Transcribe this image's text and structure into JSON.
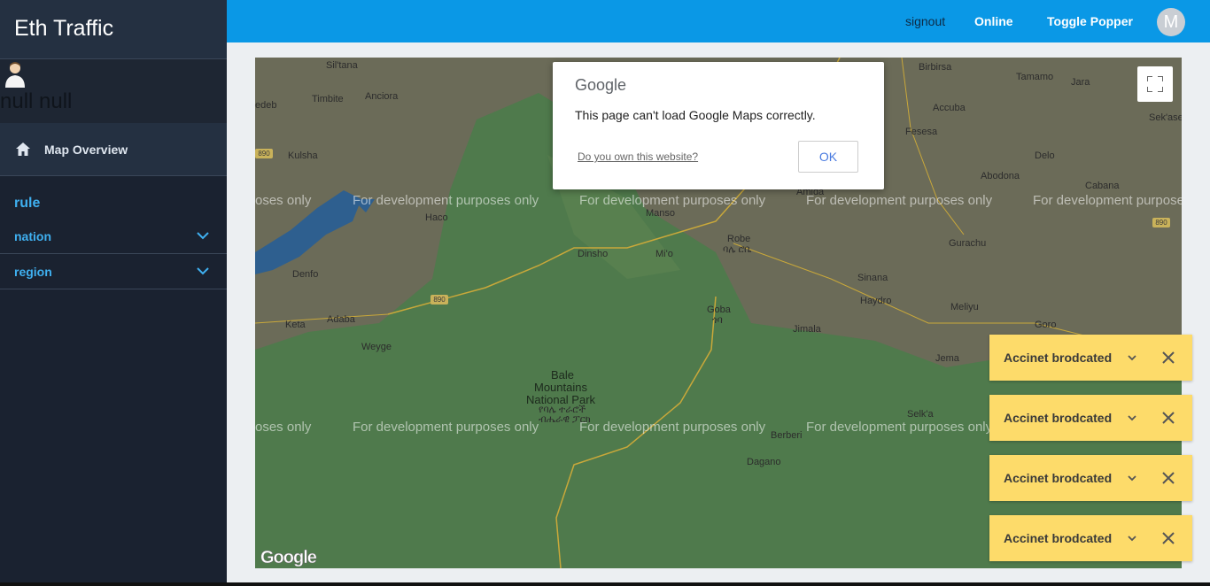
{
  "app": {
    "brand": "Eth Traffic"
  },
  "user": {
    "name": "null null"
  },
  "sidebar": {
    "overview_label": "Map Overview",
    "rule_label": "rule",
    "menus": [
      {
        "label": "nation"
      },
      {
        "label": "region"
      }
    ]
  },
  "topbar": {
    "signout": "signout",
    "status": "Online",
    "toggle": "Toggle Popper",
    "avatar_letter": "M"
  },
  "map": {
    "watermark": "For development purposes only",
    "watermark_cut": "oses only",
    "watermark_right": "For development purpose",
    "logo": "Google",
    "places": [
      "Sil'tana",
      "Anciora",
      "edeb",
      "Timbite",
      "Kulsha",
      "Haco",
      "Denfo",
      "Keta",
      "Adaba",
      "Weyge",
      "Dinsho",
      "Mi'o",
      "Manso",
      "Robe",
      "ባሌ ሮቤ",
      "Goba",
      "ጎባ",
      "Jimala",
      "Amida",
      "Sinana",
      "Haydro",
      "Gurachu",
      "Meliyu",
      "Goro",
      "Jema",
      "Selk'a",
      "Berberi",
      "Dagano",
      "Birbirsa",
      "Tamamo",
      "Jara",
      "Accuba",
      "Fesesa",
      "Delo",
      "Abodona",
      "Cabana",
      "Sek'ase",
      "Bale",
      "Mountains",
      "National Park",
      "የባሌ ተራሮች",
      "ብሔራዊ ፓርክ"
    ],
    "road_numbers": [
      "890",
      "890",
      "890"
    ]
  },
  "dialog": {
    "logo": "Google",
    "message": "This page can't load Google Maps correctly.",
    "link": "Do you own this website?",
    "ok": "OK"
  },
  "toasts": [
    {
      "label": "Accinet brodcated"
    },
    {
      "label": "Accinet brodcated"
    },
    {
      "label": "Accinet brodcated"
    },
    {
      "label": "Accinet brodcated"
    }
  ],
  "colors": {
    "topbar": "#0a98e6",
    "sidebar": "#1a2230",
    "accent_link": "#3fb0f0",
    "toast": "#fddb6a",
    "map_forest": "#4f7a4c",
    "map_land": "#6b6b58"
  }
}
